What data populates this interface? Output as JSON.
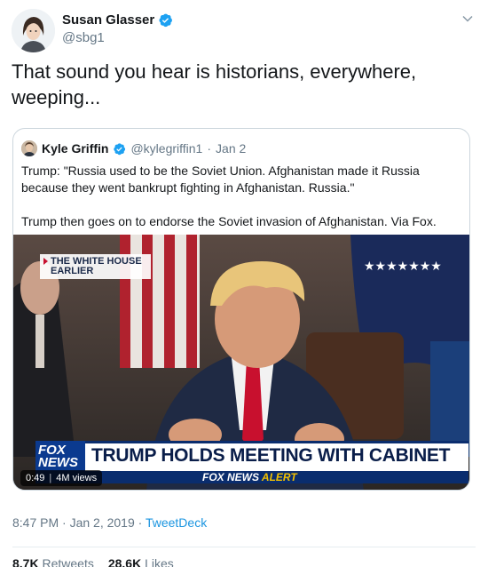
{
  "author": {
    "display_name": "Susan Glasser",
    "handle": "@sbg1",
    "verified": true
  },
  "tweet_text": "That sound you hear is historians, everywhere, weeping...",
  "quoted": {
    "display_name": "Kyle Griffin",
    "handle": "@kylegriffin1",
    "separator": "·",
    "date": "Jan 2",
    "paragraphs": [
      "Trump: \"Russia used to be the Soviet Union. Afghanistan made it Russia because they went bankrupt fighting in Afghanistan. Russia.\"",
      "Trump then goes on to endorse the Soviet invasion of Afghanistan. Via Fox."
    ],
    "video": {
      "location_tag": "THE WHITE HOUSE EARLIER",
      "headline": "TRUMP HOLDS MEETING WITH CABINET",
      "logo_text": "FOX NEWS",
      "alert_prefix": "FOX NEWS",
      "alert_word": "ALERT",
      "duration": "0:49",
      "views": "4M views"
    }
  },
  "footer": {
    "time_date": "8:47 PM · Jan 2, 2019 · ",
    "source": "TweetDeck",
    "retweets_count": "8.7K",
    "retweets_label": "Retweets",
    "likes_count": "28.6K",
    "likes_label": "Likes"
  },
  "colors": {
    "verified_blue": "#1da1f2",
    "link_blue": "#1b95e0",
    "muted_gray": "#657786",
    "border": "#ccd6dd"
  }
}
